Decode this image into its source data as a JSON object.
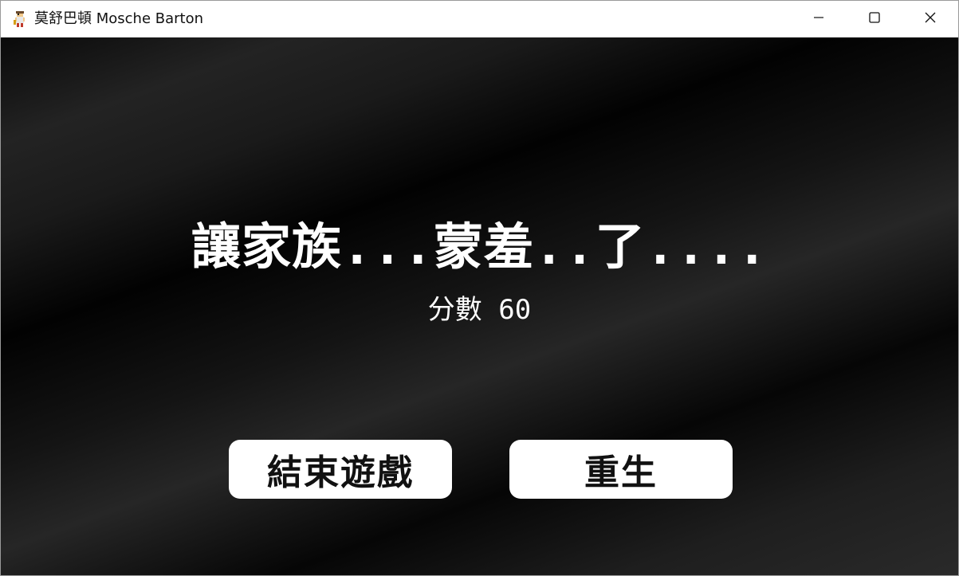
{
  "window": {
    "title": "莫舒巴頓 Mosche Barton",
    "icon": "game-character-icon",
    "controls": [
      "minimize-icon",
      "maximize-icon",
      "close-icon"
    ]
  },
  "game_over": {
    "message": "讓家族...蒙羞..了....",
    "score_text": "分數 60",
    "score": 60
  },
  "buttons": {
    "quit_label": "結束遊戲",
    "respawn_label": "重生"
  },
  "colors": {
    "background": "#0a0a0a",
    "text": "#ffffff",
    "button_bg": "#ffffff",
    "button_text": "#111111"
  }
}
